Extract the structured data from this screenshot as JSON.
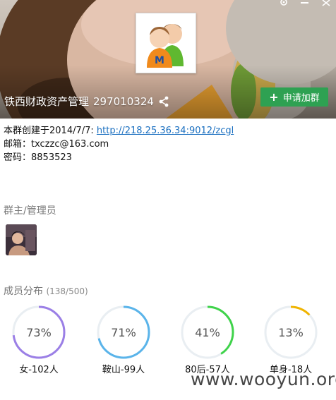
{
  "header": {
    "group_name": "铁西财政资产管理",
    "group_id": "297010324",
    "join_button": "申请加群"
  },
  "description": {
    "created_prefix": "本群创建于2014/7/7: ",
    "link": "http://218.25.36.34:9012/zcgl",
    "email": "邮箱：txczzc@163.com",
    "password": "密码：8853523"
  },
  "admins": {
    "title": "群主/管理员"
  },
  "members": {
    "title": "成员分布",
    "count": "(138/500)",
    "stats": [
      {
        "percent_label": "73%",
        "percent": 73,
        "label": "女-102人",
        "color": "#9b7fe6"
      },
      {
        "percent_label": "71%",
        "percent": 71,
        "label": "鞍山-99人",
        "color": "#5ab4ea"
      },
      {
        "percent_label": "41%",
        "percent": 41,
        "label": "80后-57人",
        "color": "#3fd34a"
      },
      {
        "percent_label": "13%",
        "percent": 13,
        "label": "单身-18人",
        "color": "#f0b400"
      }
    ]
  },
  "watermark": "www.wooyun.org",
  "icons": {
    "share": "share-icon",
    "plus": "plus-icon",
    "settings": "settings-icon",
    "minimize": "minimize-icon"
  }
}
